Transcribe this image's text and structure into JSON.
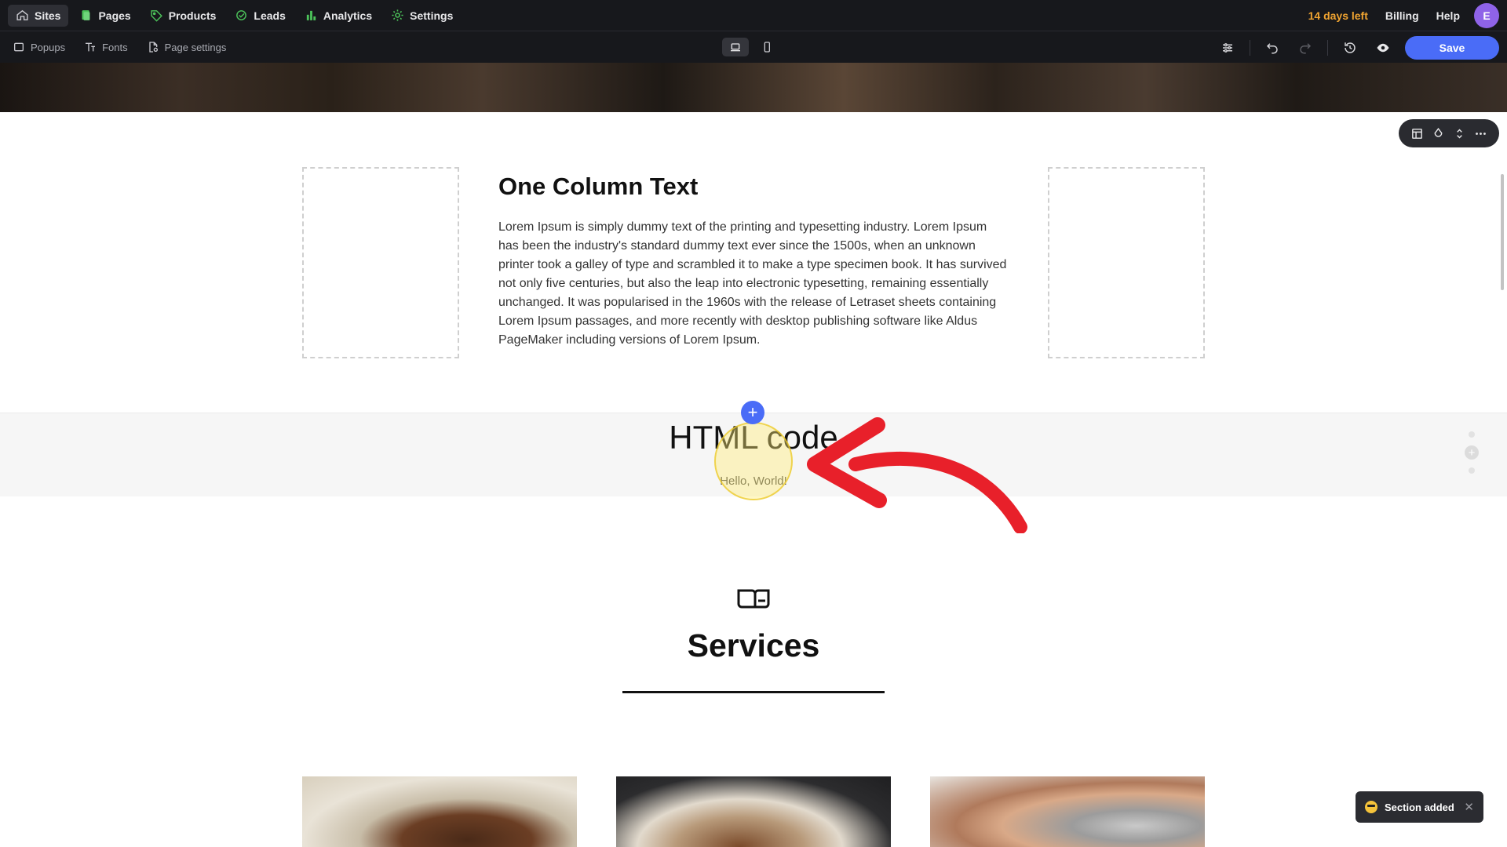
{
  "nav": {
    "items": [
      {
        "label": "Sites",
        "icon": "home-icon"
      },
      {
        "label": "Pages",
        "icon": "pages-icon"
      },
      {
        "label": "Products",
        "icon": "tag-icon"
      },
      {
        "label": "Leads",
        "icon": "target-icon"
      },
      {
        "label": "Analytics",
        "icon": "bar-chart-icon"
      },
      {
        "label": "Settings",
        "icon": "gear-icon"
      }
    ],
    "trial": "14 days left",
    "billing": "Billing",
    "help": "Help",
    "avatar_initial": "E"
  },
  "toolbar": {
    "popups": "Popups",
    "fonts": "Fonts",
    "page_settings": "Page settings",
    "save": "Save"
  },
  "content": {
    "one_column": {
      "title": "One Column Text",
      "body": "Lorem Ipsum is simply dummy text of the printing and typesetting industry. Lorem Ipsum has been the industry's standard dummy text ever since the 1500s, when an unknown printer took a galley of type and scrambled it to make a type specimen book. It has survived not only five centuries, but also the leap into electronic typesetting, remaining essentially unchanged. It was popularised in the 1960s with the release of Letraset sheets containing Lorem Ipsum passages, and more recently with desktop publishing software like Aldus PageMaker including versions of Lorem Ipsum."
    },
    "html_code": {
      "title": "HTML code",
      "subtitle": "Hello, World!"
    },
    "services": {
      "title": "Services"
    }
  },
  "toast": {
    "message": "Section added"
  },
  "colors": {
    "nav_bg": "#17181c",
    "accent": "#4a6cf7",
    "trial": "#f0a431",
    "nav_icon_green": "#4cc35a",
    "avatar": "#8f63e8",
    "annotation_arrow": "#e8202a"
  }
}
